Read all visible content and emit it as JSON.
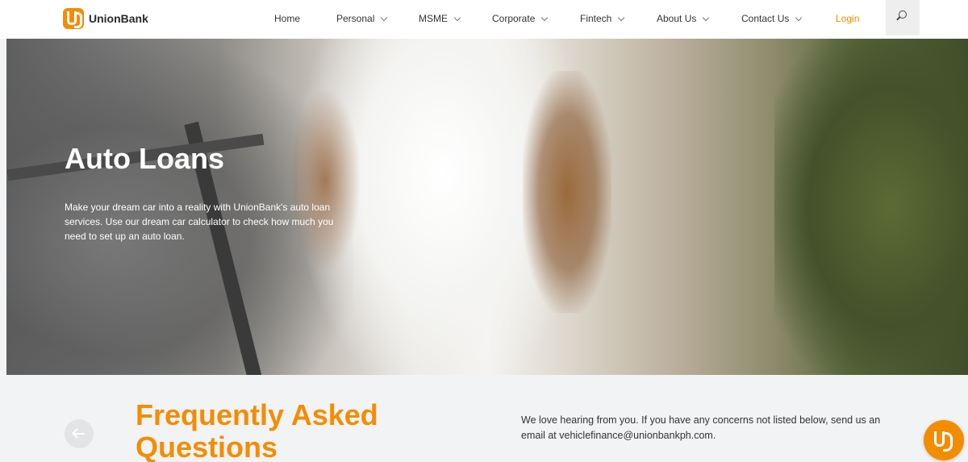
{
  "header": {
    "brand": "UnionBank",
    "nav": [
      {
        "label": "Home",
        "has_dropdown": false
      },
      {
        "label": "Personal",
        "has_dropdown": true
      },
      {
        "label": "MSME",
        "has_dropdown": true
      },
      {
        "label": "Corporate",
        "has_dropdown": true
      },
      {
        "label": "Fintech",
        "has_dropdown": true
      },
      {
        "label": "About Us",
        "has_dropdown": true
      },
      {
        "label": "Contact Us",
        "has_dropdown": true
      }
    ],
    "login": "Login",
    "search_icon": "search-icon"
  },
  "hero": {
    "title": "Auto Loans",
    "description": "Make your dream car into a reality with UnionBank's auto loan services. Use our dream car calculator to check how much you need to set up an auto loan."
  },
  "faq": {
    "title": "Frequently Asked Questions",
    "text": "We love hearing from you. If you have any concerns not listed below, send us an email at vehiclefinance@unionbankph.com.",
    "back_icon": "arrow-left-icon"
  },
  "colors": {
    "brand_orange": "#f28d00",
    "background": "#f2f3f5"
  }
}
